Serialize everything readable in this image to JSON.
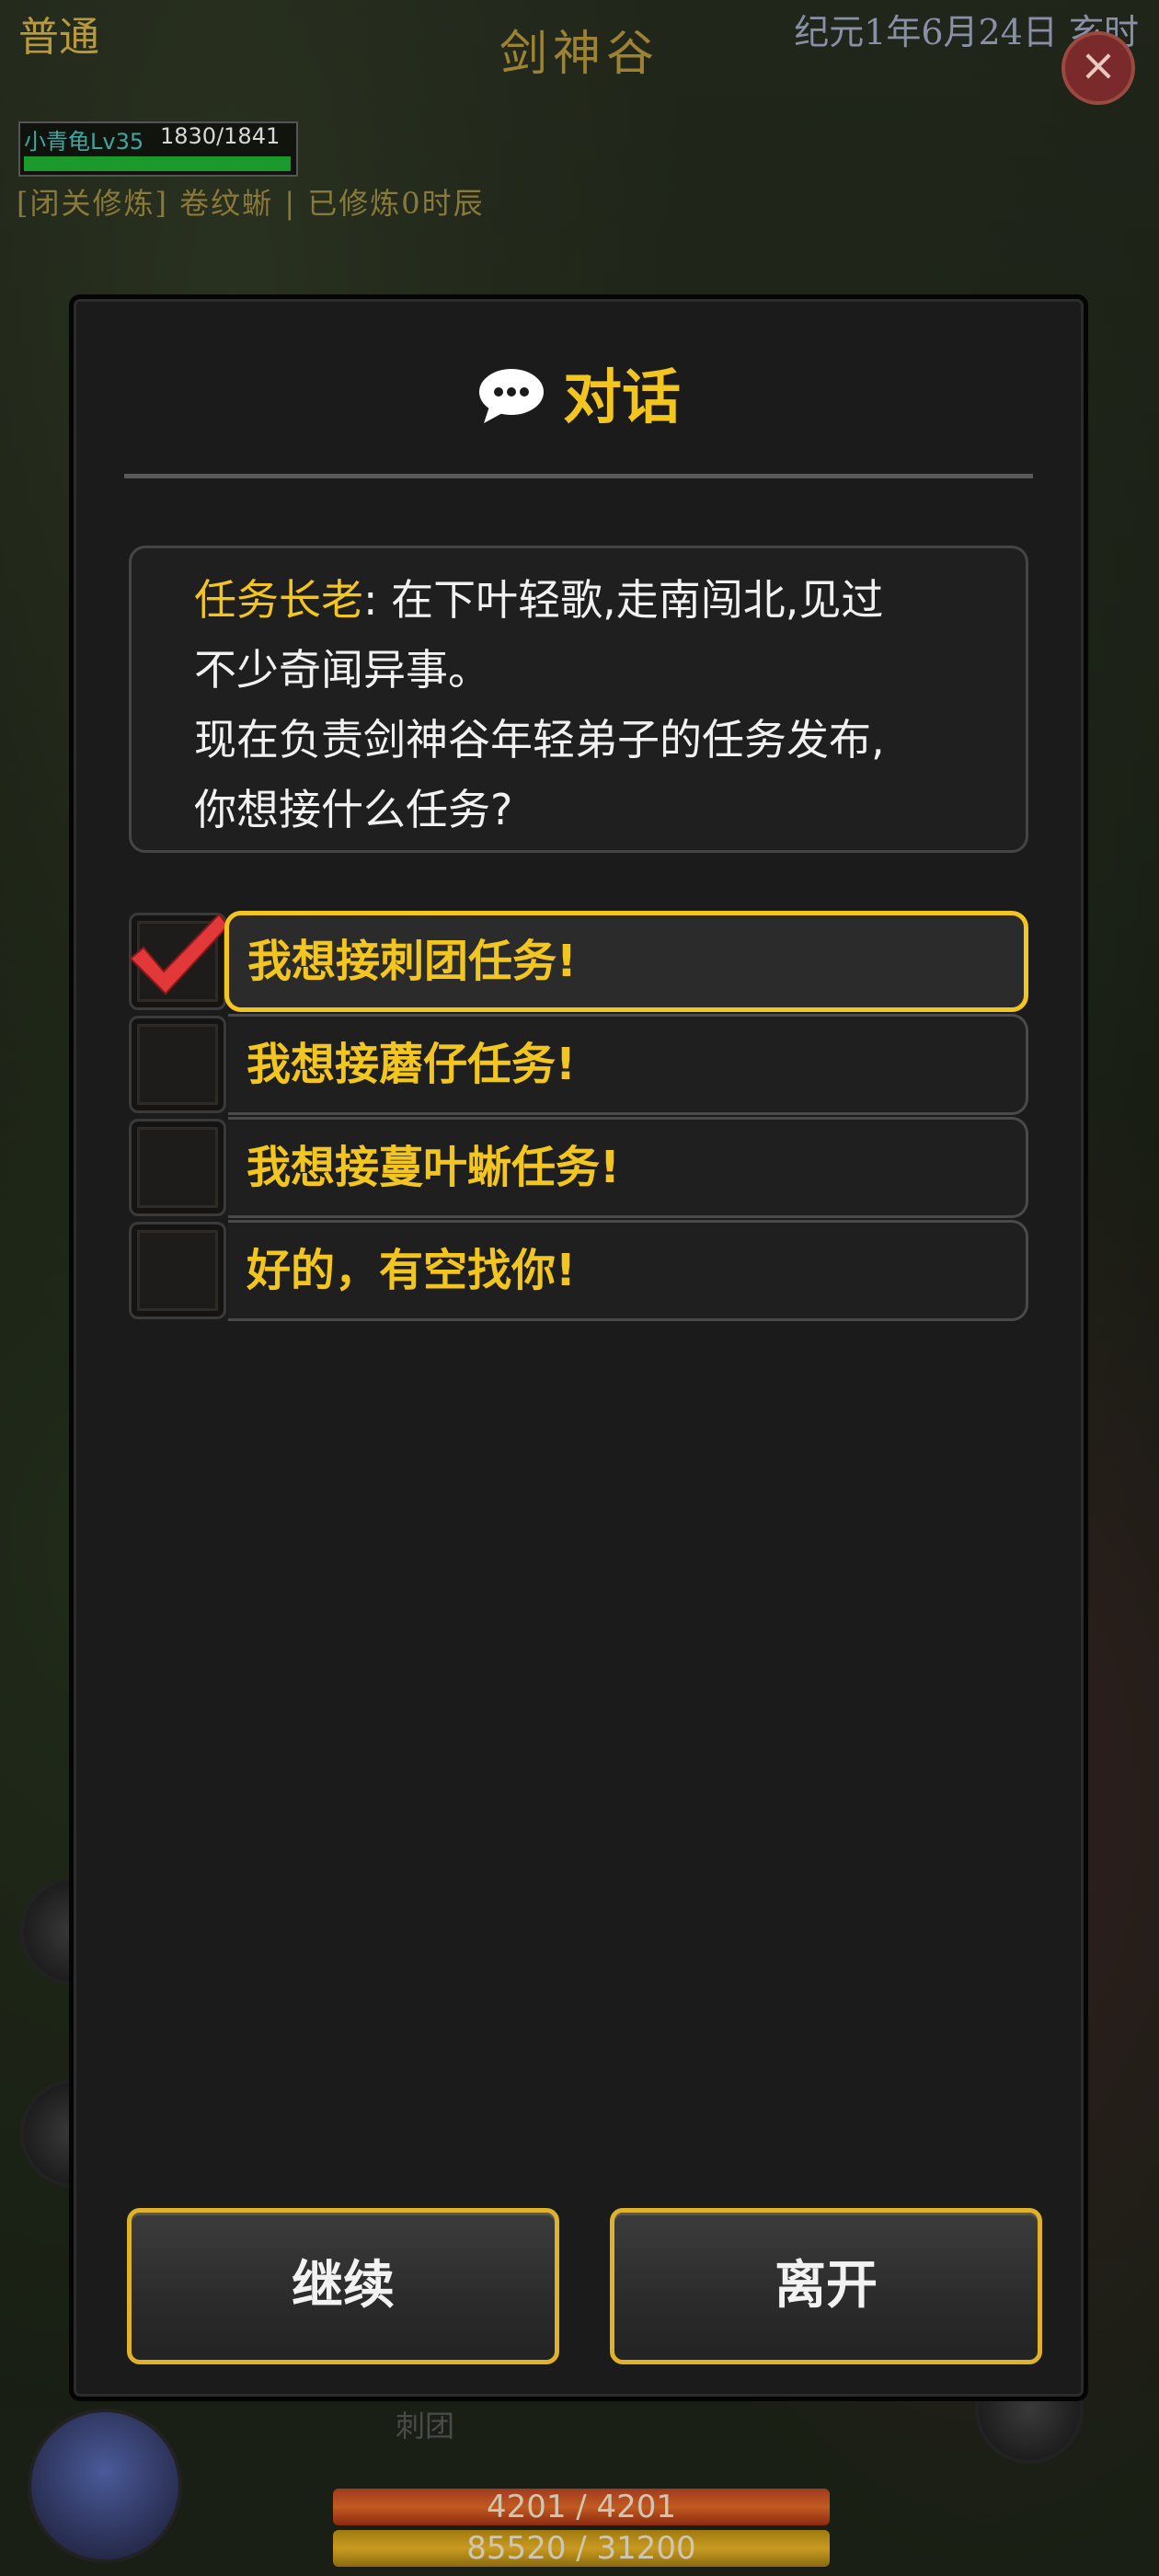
{
  "hud": {
    "mode": "普通",
    "location": "剑神谷",
    "date": "纪元1年6月24日 亥时",
    "close_icon": "×",
    "character": {
      "name_level": "小青龟Lv35",
      "hp_text": "1830/1841"
    },
    "status": "[闭关修炼] 卷纹蜥 | 已修炼0时辰",
    "skill_tag": "刺团",
    "bottom_hp": "4201  /  4201",
    "bottom_mp": "85520  /  31200"
  },
  "dialog": {
    "title": "对话",
    "title_icon": "speech-bubble-icon",
    "speaker": "任务长老",
    "speech_line1": ": 在下叶轻歌,走南闯北,见过",
    "speech_line2": "不少奇闻异事。",
    "speech_line3": "现在负责剑神谷年轻弟子的任务发布,",
    "speech_line4": "你想接什么任务?",
    "options": [
      {
        "label": "我想接刺团任务!",
        "selected": true
      },
      {
        "label": "我想接蘑仔任务!",
        "selected": false
      },
      {
        "label": "我想接蔓叶蜥任务!",
        "selected": false
      },
      {
        "label": "好的，有空找你!",
        "selected": false
      }
    ],
    "continue_label": "继续",
    "leave_label": "离开"
  },
  "colors": {
    "accent": "#f3c51f",
    "panel": "#1b1b1b",
    "check": "#e03a3a"
  }
}
